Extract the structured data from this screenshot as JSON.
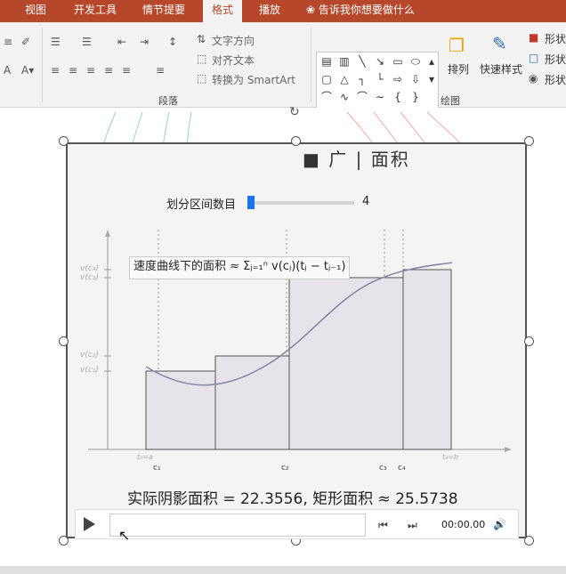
{
  "tabs": [
    "视图",
    "开发工具",
    "情节提要",
    "格式",
    "播放"
  ],
  "active_tab": "格式",
  "tell_me": "告诉我你想要做什么",
  "ribbon": {
    "text_direction": "文字方向",
    "align_text": "对齐文本",
    "convert_smartart": "转换为 SmartArt",
    "paragraph_group": "段落",
    "drawing_group": "绘图",
    "arrange": "排列",
    "quick_styles": "快速样式",
    "shape_fill": "形状",
    "shape_outline": "形状",
    "shape_effects": "形状"
  },
  "slide": {
    "title_fragment": "■ 广 | 面积",
    "slider_label": "划分区间数目",
    "slider_value": "4",
    "slider_fraction": 0.02,
    "formula_label": "速度曲线下的面积 ≈ Σⱼ₌₁ⁿ v(cⱼ)(tⱼ − tⱼ₋₁)",
    "result": "实际阴影面积 = 22.3556, 矩形面积 ≈ 25.5738",
    "ylabels": [
      "v(c₄)",
      "v(c₃)",
      "v(c₂)",
      "v(c₁)"
    ],
    "xlabels": [
      "t₀=a",
      "c₁",
      "c₂",
      "c₃",
      "c₄",
      "t₄=b"
    ],
    "time": "00:00.00"
  }
}
